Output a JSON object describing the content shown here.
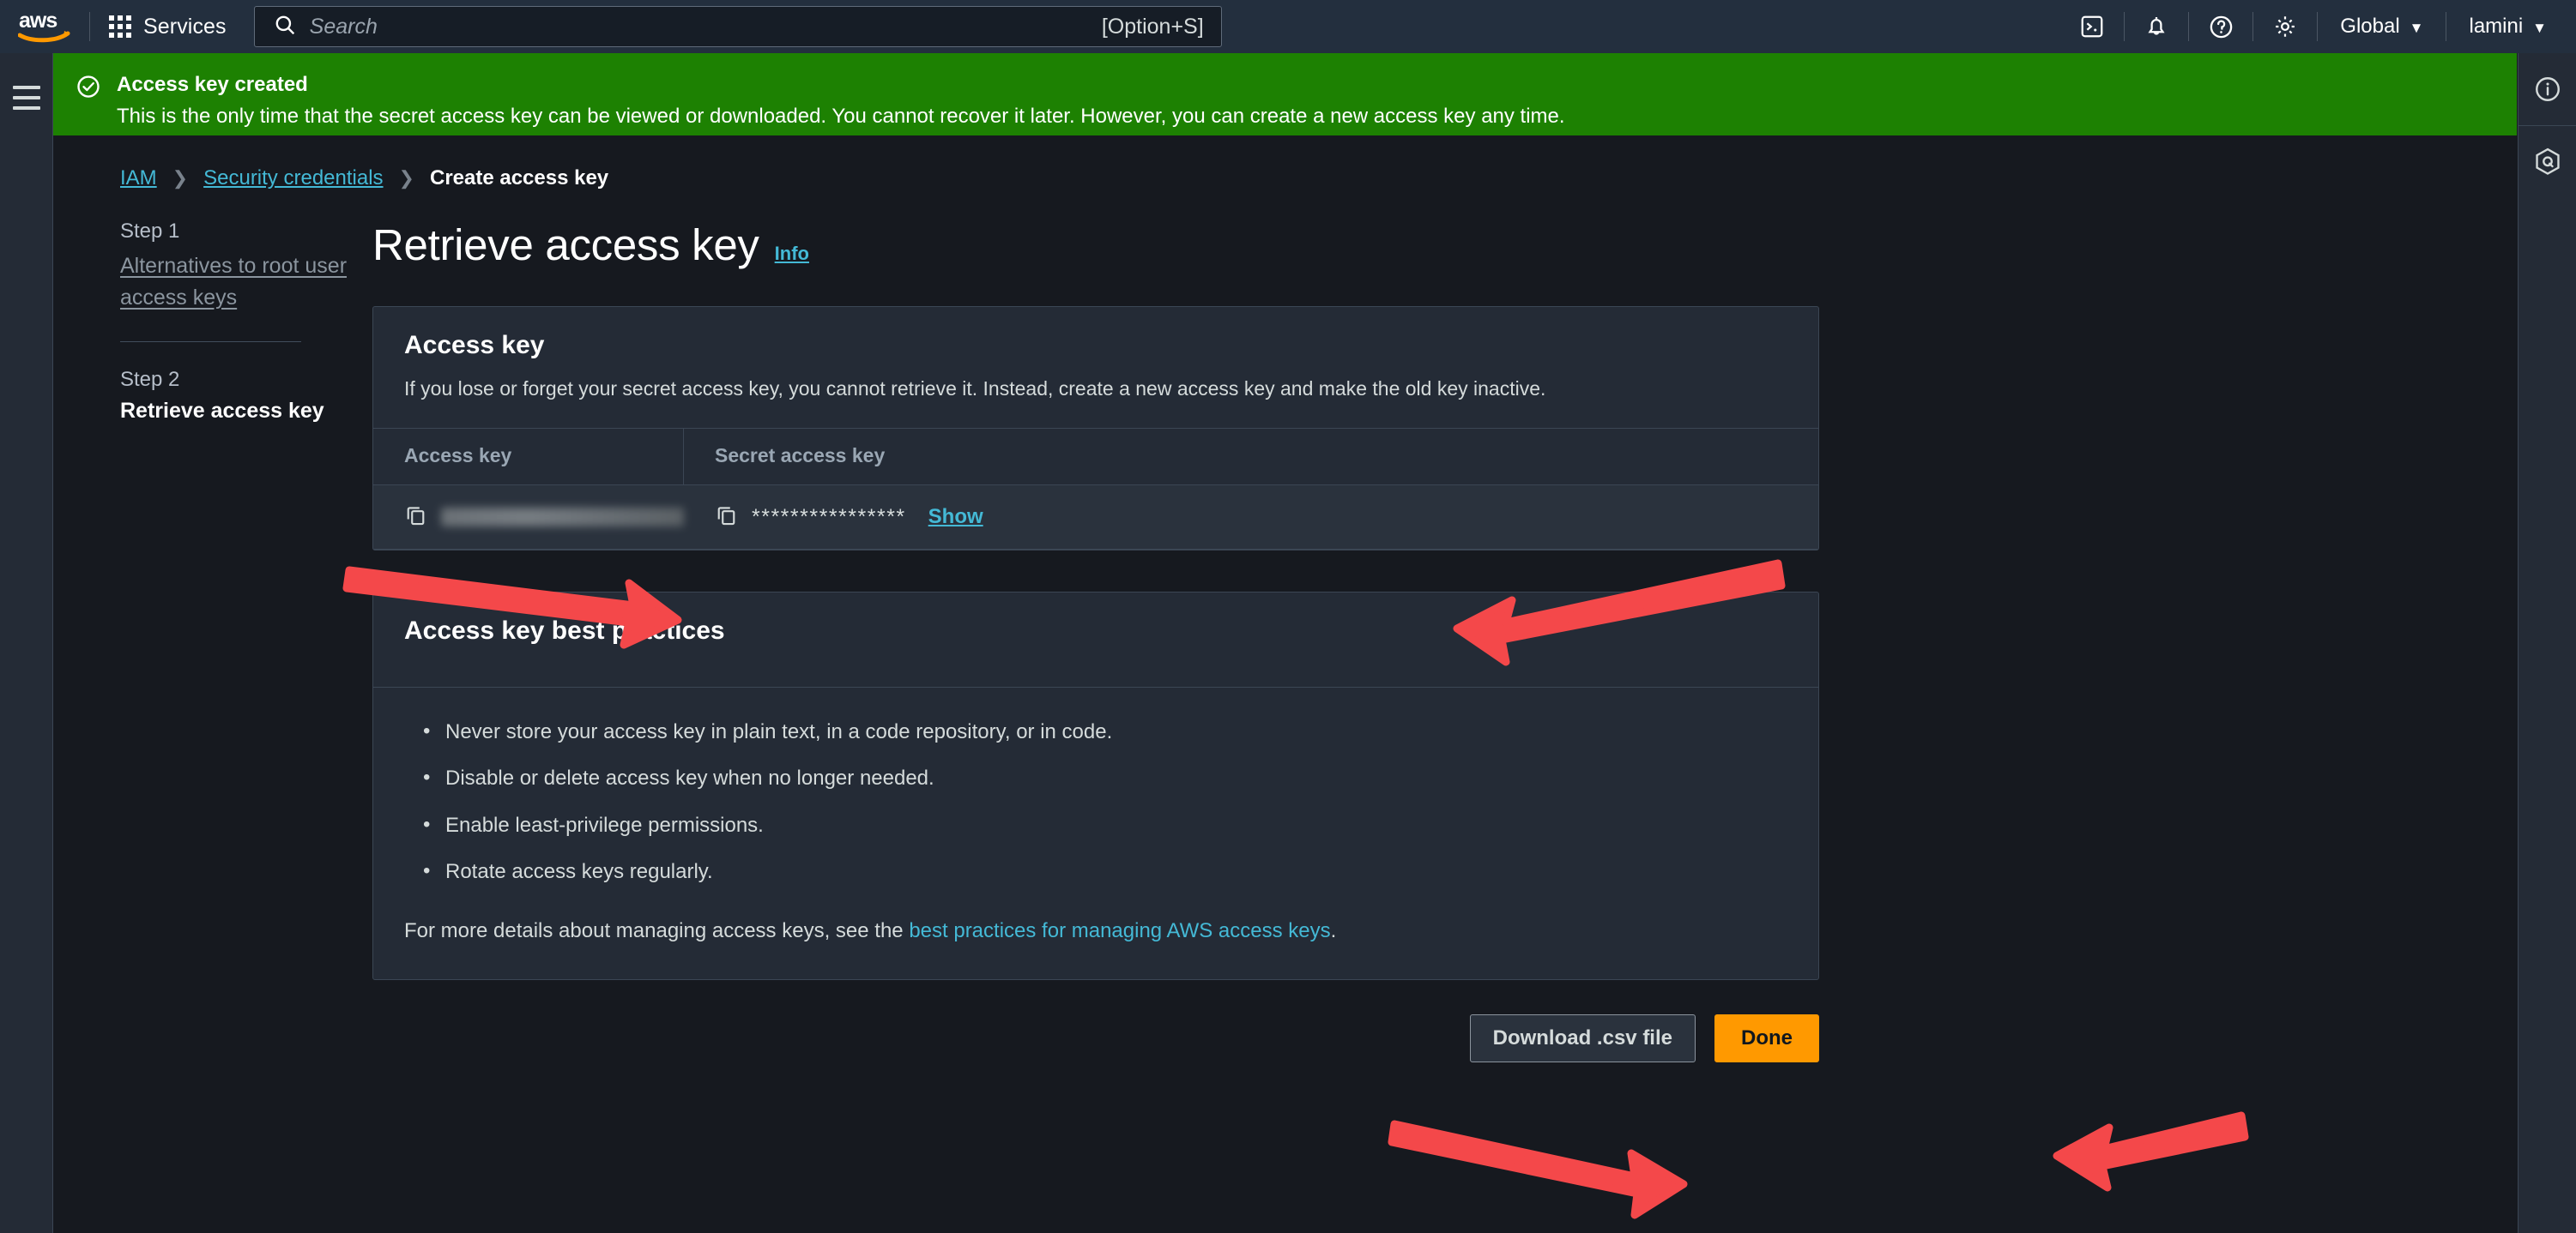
{
  "colors": {
    "nav_bg": "#232f3e",
    "page_bg": "#16191f",
    "panel_bg": "#242b36",
    "row_bg": "#2a323d",
    "border": "#3b4654",
    "link": "#44b9d6",
    "success_green": "#1d8102",
    "primary_orange": "#ff9900",
    "annotation_red": "#f4484a",
    "text": "#d5dbdb",
    "muted": "#9aa7b4"
  },
  "topnav": {
    "logo_icon": "aws-logo",
    "services_label": "Services",
    "services_icon": "grid-apps-icon",
    "search": {
      "icon": "search-icon",
      "value": "",
      "placeholder": "Search",
      "shortcut": "[Option+S]"
    },
    "icons": [
      {
        "name": "cloudshell-icon",
        "title": "CloudShell"
      },
      {
        "name": "bell-icon",
        "title": "Notifications"
      },
      {
        "name": "question-circle-icon",
        "title": "Help"
      },
      {
        "name": "gear-icon",
        "title": "Settings"
      }
    ],
    "region_label": "Global",
    "account_label": "lamini",
    "caret": "▼"
  },
  "left_rail": {
    "menu_icon": "hamburger-menu-icon"
  },
  "right_rail": {
    "items": [
      {
        "name": "info-circle-icon"
      },
      {
        "name": "amazon-q-hexagon-icon"
      }
    ]
  },
  "flash": {
    "icon": "check-circle-icon",
    "title": "Access key created",
    "body": "This is the only time that the secret access key can be viewed or downloaded. You cannot recover it later. However, you can create a new access key any time."
  },
  "breadcrumb": {
    "items": [
      {
        "label": "IAM",
        "current": false
      },
      {
        "label": "Security credentials",
        "current": false
      },
      {
        "label": "Create access key",
        "current": true
      }
    ],
    "separator": "❯"
  },
  "steps": [
    {
      "number": "Step 1",
      "label": "Alternatives to root user access keys",
      "active": false
    },
    {
      "number": "Step 2",
      "label": "Retrieve access key",
      "active": true
    }
  ],
  "page": {
    "title": "Retrieve access key",
    "info_label": "Info"
  },
  "access_key_card": {
    "heading": "Access key",
    "description": "If you lose or forget your secret access key, you cannot retrieve it. Instead, create a new access key and make the old key inactive.",
    "columns": [
      "Access key",
      "Secret access key"
    ],
    "row": {
      "access_key_value": "",
      "access_key_redacted": true,
      "copy_icon": "copy-icon",
      "secret_masked_value": "****************",
      "show_label": "Show"
    }
  },
  "best_practices_card": {
    "heading": "Access key best practices",
    "bullets": [
      "Never store your access key in plain text, in a code repository, or in code.",
      "Disable or delete access key when no longer needed.",
      "Enable least-privilege permissions.",
      "Rotate access keys regularly."
    ],
    "more_prefix": "For more details about managing access keys, see the ",
    "more_link": "best practices for managing AWS access keys",
    "more_suffix": "."
  },
  "footer": {
    "download_label": "Download .csv file",
    "done_label": "Done"
  },
  "annotations": [
    {
      "name": "arrow-to-access-key-copy",
      "direction": "right"
    },
    {
      "name": "arrow-to-show-link",
      "direction": "left"
    },
    {
      "name": "arrow-to-download-csv-button",
      "direction": "right"
    },
    {
      "name": "arrow-to-done-button",
      "direction": "left"
    }
  ]
}
